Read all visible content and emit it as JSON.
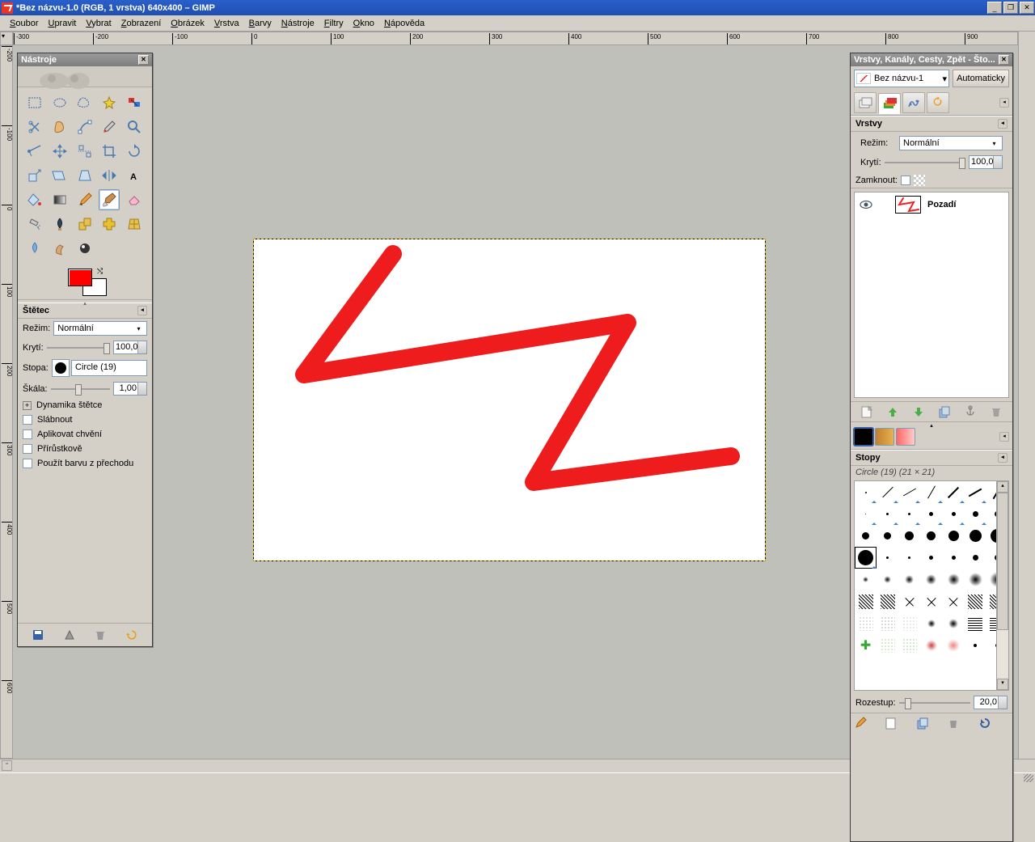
{
  "title": "*Bez názvu-1.0 (RGB, 1 vrstva) 640x400 – GIMP",
  "menu": [
    "Soubor",
    "Upravit",
    "Vybrat",
    "Zobrazení",
    "Obrázek",
    "Vrstva",
    "Barvy",
    "Nástroje",
    "Filtry",
    "Okno",
    "Nápověda"
  ],
  "ruler_marks": [
    "-300",
    "-200",
    "-100",
    "0",
    "100",
    "200",
    "300",
    "400",
    "500",
    "600",
    "700",
    "800",
    "900"
  ],
  "ruler_marks_v": [
    "-200",
    "-100",
    "0",
    "100",
    "200",
    "300",
    "400",
    "500",
    "600"
  ],
  "toolbox": {
    "title": "Nástroje",
    "options_title": "Štětec",
    "mode_label": "Režim:",
    "mode_value": "Normální",
    "opacity_label": "Krytí:",
    "opacity_value": "100,0",
    "brush_label": "Stopa:",
    "brush_value": "Circle (19)",
    "scale_label": "Škála:",
    "scale_value": "1,00",
    "dyn_label": "Dynamika štětce",
    "fade_label": "Slábnout",
    "jitter_label": "Aplikovat chvění",
    "inc_label": "Přírůstkově",
    "grad_label": "Použít barvu z přechodu"
  },
  "rdock": {
    "title": "Vrstvy, Kanály, Cesty, Zpět - Što...",
    "image_name": "Bez názvu-1",
    "auto": "Automaticky",
    "layers_label": "Vrstvy",
    "mode_label": "Režim:",
    "mode_value": "Normální",
    "opacity_label": "Krytí:",
    "opacity_value": "100,0",
    "lock_label": "Zamknout:",
    "layer_name": "Pozadí",
    "brushes_label": "Stopy",
    "brush_info": "Circle (19) (21 × 21)",
    "spacing_label": "Rozestup:",
    "spacing_value": "20,0"
  }
}
